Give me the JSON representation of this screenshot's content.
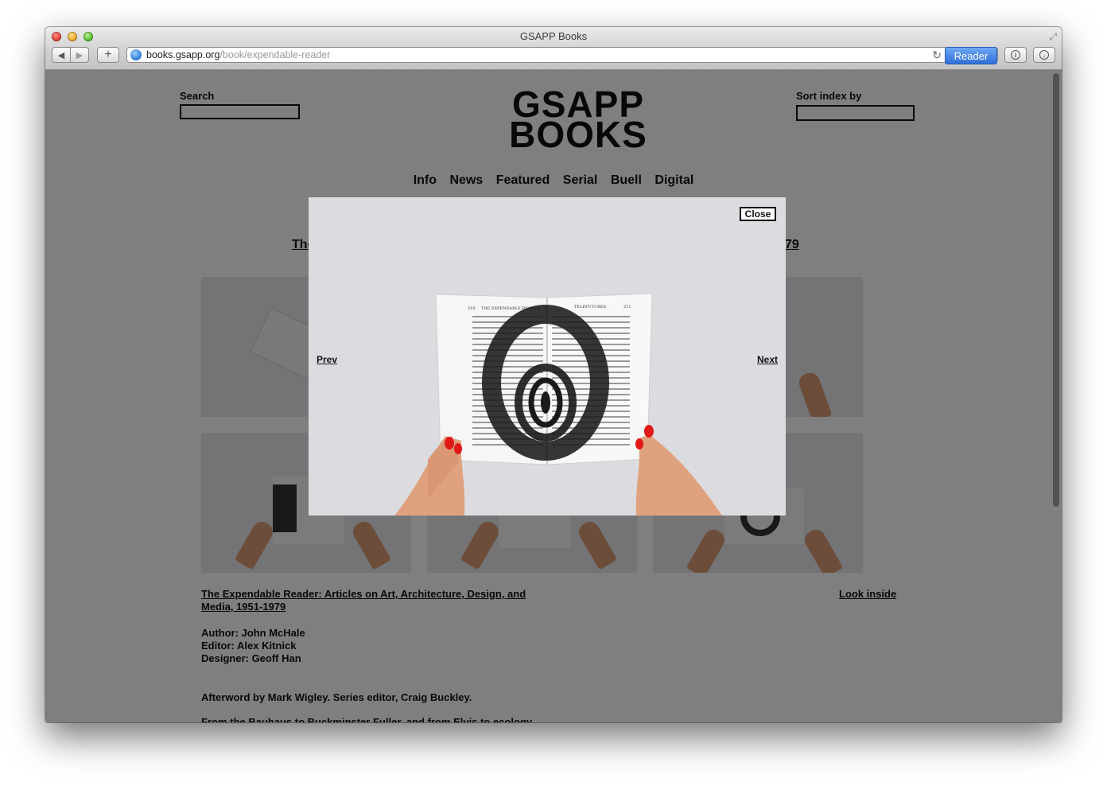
{
  "browser": {
    "title": "GSAPP Books",
    "url_host": "books.gsapp.org",
    "url_path": "/book/expendable-reader",
    "reader_label": "Reader"
  },
  "page": {
    "search_label": "Search",
    "sort_label": "Sort index by",
    "logo_line1": "GSAPP",
    "logo_line2": "BOOKS",
    "nav": [
      "Info",
      "News",
      "Featured",
      "Serial",
      "Buell",
      "Digital"
    ],
    "title_fragment_left": "The",
    "title_fragment_right": "79",
    "book_title": "The Expendable Reader: Articles on Art, Architecture, Design, and Media, 1951-1979",
    "look_inside": "Look inside",
    "credits": [
      "Author: John McHale",
      "Editor: Alex Kitnick",
      "Designer: Geoff Han"
    ],
    "afterword": "Afterword by Mark Wigley. Series editor, Craig Buckley.",
    "teaser": "From the Bauhaus to Buckminster Fuller, and from Elvis to ecology"
  },
  "lightbox": {
    "close_label": "Close",
    "prev_label": "Prev",
    "next_label": "Next",
    "left_header_number": "210",
    "left_header_title": "THE EXPENDABLE READER",
    "right_header_title": "TELEFUTURES",
    "right_header_number": "211"
  }
}
